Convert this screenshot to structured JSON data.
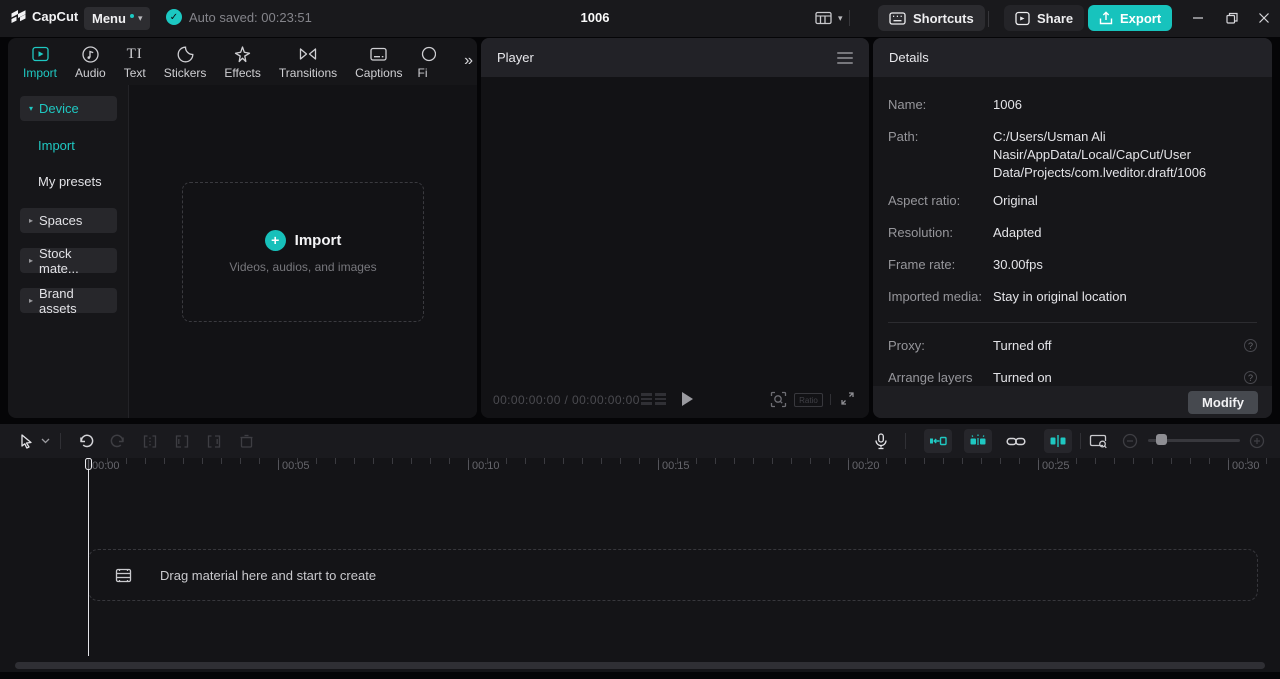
{
  "colors": {
    "accent": "#1cc8c2",
    "export_button": "#17c3bd",
    "panel_bg": "#161619",
    "titlebar_bg": "#19191c"
  },
  "glyphs": {
    "caret_down": "▾",
    "caret_right": "▸",
    "double_chevron": "»",
    "check": "✓",
    "plus": "+",
    "question": "?",
    "text_tab": "TI"
  },
  "titlebar": {
    "app_name": "CapCut",
    "menu_label": "Menu",
    "autosave_text": "Auto saved: 00:23:51",
    "project_title": "1006",
    "shortcuts_label": "Shortcuts",
    "share_label": "Share",
    "export_label": "Export"
  },
  "media": {
    "tabs": [
      "Import",
      "Audio",
      "Text",
      "Stickers",
      "Effects",
      "Transitions",
      "Captions",
      "Fi"
    ],
    "active_tab": "Import",
    "sidebar": {
      "device": "Device",
      "import": "Import",
      "my_presets": "My presets",
      "spaces": "Spaces",
      "stock_materials": "Stock mate...",
      "brand_assets": "Brand assets"
    },
    "dropzone": {
      "title": "Import",
      "subtitle": "Videos, audios, and images"
    }
  },
  "player": {
    "title": "Player",
    "timecode": "00:00:00:00 / 00:00:00:00",
    "ratio_label": "Ratio"
  },
  "details": {
    "title": "Details",
    "rows": [
      {
        "label": "Name:",
        "value": "1006"
      },
      {
        "label": "Path:",
        "value": "C:/Users/Usman Ali Nasir/AppData/Local/CapCut/User Data/Projects/com.lveditor.draft/1006"
      },
      {
        "label": "Aspect ratio:",
        "value": "Original"
      },
      {
        "label": "Resolution:",
        "value": "Adapted"
      },
      {
        "label": "Frame rate:",
        "value": "30.00fps"
      },
      {
        "label": "Imported media:",
        "value": "Stay in original location"
      },
      {
        "label": "Proxy:",
        "value": "Turned off"
      },
      {
        "label": "Arrange layers",
        "value": "Turned on"
      }
    ],
    "modify_label": "Modify"
  },
  "timeline": {
    "ruler_labels": [
      "00:00",
      "00:05",
      "00:10",
      "00:15",
      "00:20",
      "00:25",
      "00:30"
    ],
    "drop_text": "Drag material here and start to create"
  }
}
